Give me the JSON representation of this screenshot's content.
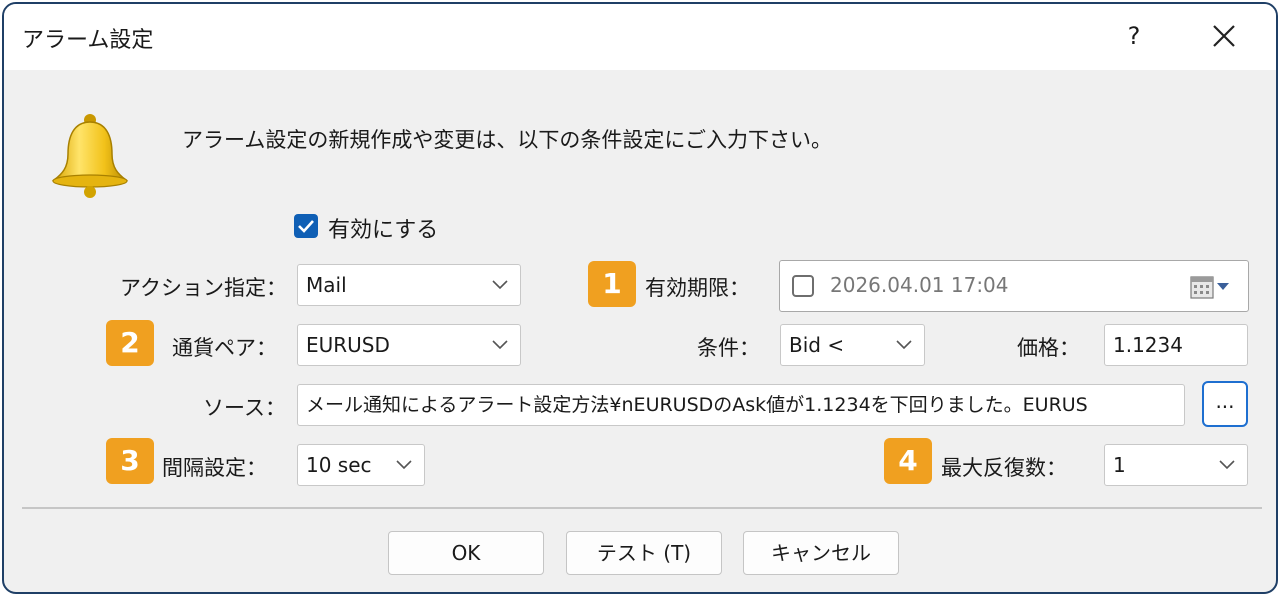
{
  "window": {
    "title": "アラーム設定",
    "help_label": "?"
  },
  "intro": "アラーム設定の新規作成や変更は、以下の条件設定にご入力下さい。",
  "enable": {
    "label": "有効にする",
    "checked": true
  },
  "action": {
    "label": "アクション指定：",
    "value": "Mail"
  },
  "expiry": {
    "badge": "1",
    "label": "有効期限：",
    "value": "2026.04.01 17:04",
    "checked": false
  },
  "pair": {
    "badge": "2",
    "label": "通貨ペア：",
    "value": "EURUSD"
  },
  "condition": {
    "label": "条件：",
    "value": "Bid <"
  },
  "price": {
    "label": "価格：",
    "value": "1.1234"
  },
  "source": {
    "label": "ソース：",
    "value": "メール通知によるアラート設定方法¥nEURUSDのAsk値が1.1234を下回りました。EURUS",
    "browse_label": "..."
  },
  "interval": {
    "badge": "3",
    "label": "間隔設定：",
    "value": "10 sec"
  },
  "repeat": {
    "badge": "4",
    "label": "最大反復数：",
    "value": "1"
  },
  "buttons": {
    "ok": "OK",
    "test": "テスト (T)",
    "cancel": "キャンセル"
  },
  "colors": {
    "badge": "#f0a020",
    "accent": "#0f5fb5",
    "window_border": "#1f3f66"
  },
  "icons": {
    "bell": "bell-icon",
    "calendar": "calendar-icon",
    "close": "close-icon"
  }
}
